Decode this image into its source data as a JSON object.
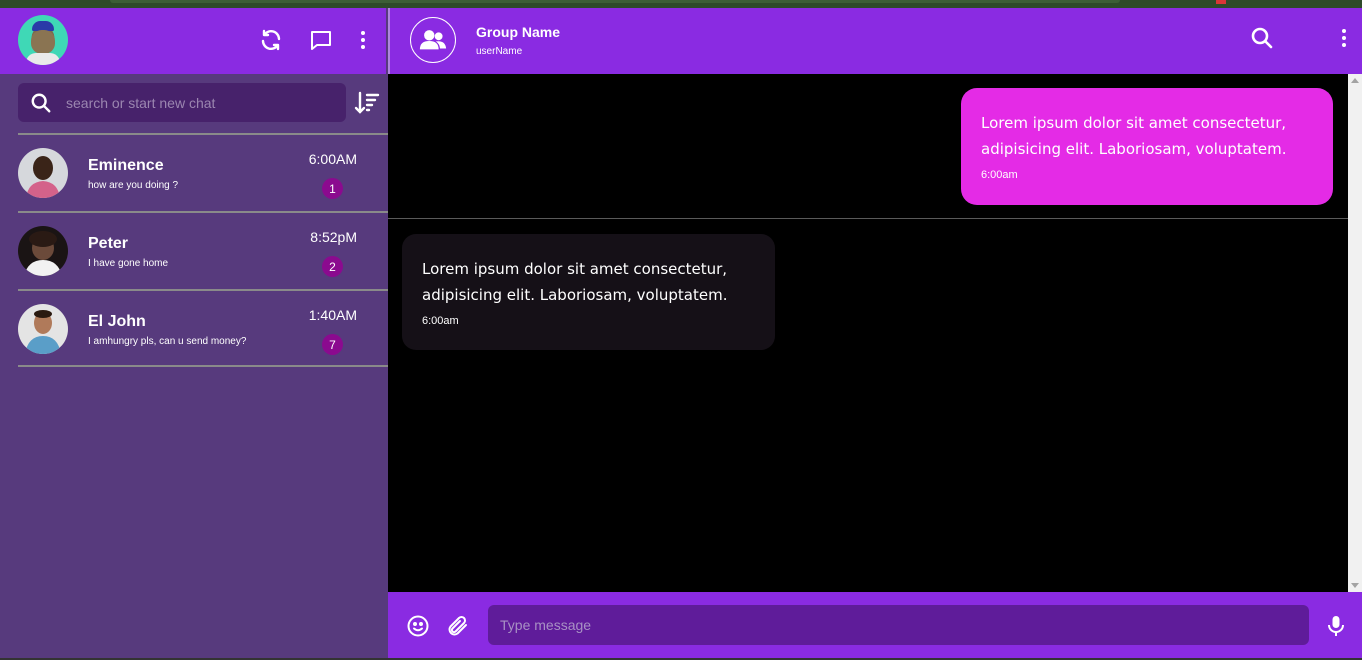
{
  "sidebar": {
    "search_placeholder": "search or start new chat",
    "chats": [
      {
        "name": "Eminence",
        "message": "how are you doing ?",
        "time": "6:00AM",
        "unread": "1"
      },
      {
        "name": "Peter",
        "message": "I have gone home",
        "time": "8:52pM",
        "unread": "2"
      },
      {
        "name": "El John",
        "message": "I amhungry pls, can u send money?",
        "time": "1:40AM",
        "unread": "7"
      }
    ]
  },
  "header": {
    "group_name": "Group Name",
    "user_name": "userName"
  },
  "messages": [
    {
      "direction": "outgoing",
      "text": "Lorem ipsum dolor sit amet consectetur, adipisicing elit. Laboriosam, voluptatem.",
      "time": "6:00am"
    },
    {
      "direction": "incoming",
      "text": "Lorem ipsum dolor sit amet consectetur, adipisicing elit. Laboriosam, voluptatem.",
      "time": "6:00am"
    }
  ],
  "footer": {
    "input_placeholder": "Type message"
  },
  "colors": {
    "header_purple": "#8a2be2",
    "sidebar_bg": "#573a7d",
    "outgoing_bubble": "#e42be6",
    "incoming_bubble": "#151017",
    "badge": "#8b0a8f"
  },
  "icons": {
    "header_left": [
      "refresh-icon",
      "chat-bubble-icon",
      "more-vertical-icon"
    ],
    "header_right": [
      "search-icon",
      "more-vertical-icon"
    ],
    "footer": [
      "emoji-icon",
      "paperclip-icon",
      "microphone-icon"
    ],
    "sort": "sort-descending-icon",
    "group": "group-users-icon"
  }
}
